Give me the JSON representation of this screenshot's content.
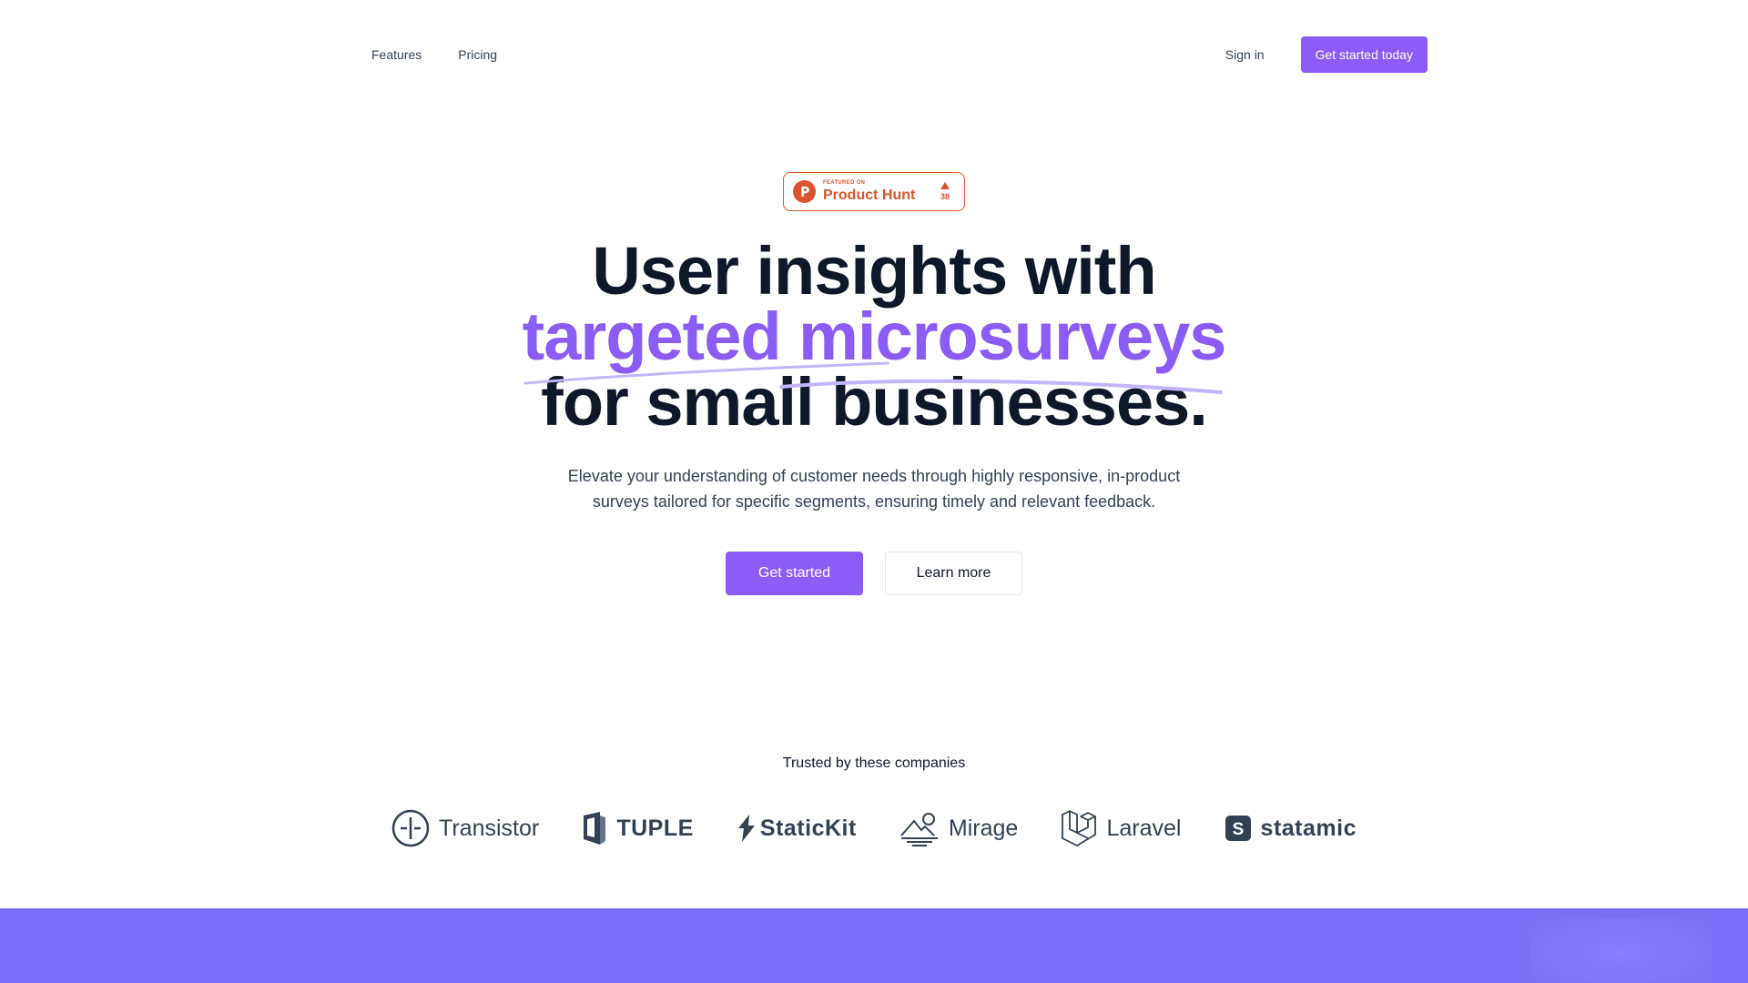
{
  "header": {
    "nav": [
      {
        "label": "Features"
      },
      {
        "label": "Pricing"
      }
    ],
    "sign_in_label": "Sign in",
    "cta_label": "Get started today"
  },
  "badge": {
    "featured_label": "FEATURED ON",
    "name": "Product Hunt",
    "votes": "38",
    "icon": "product-hunt-icon"
  },
  "hero": {
    "line1": "User insights with",
    "line2": "targeted microsurveys",
    "line3": "for small businesses.",
    "subtitle_line1": "Elevate your understanding of customer needs through highly responsive, in-product",
    "subtitle_line2": "surveys tailored for specific segments, ensuring timely and relevant feedback.",
    "primary_button": "Get started",
    "secondary_button": "Learn more"
  },
  "trusted": {
    "heading": "Trusted by these companies",
    "logos": [
      {
        "name": "Transistor",
        "icon": "transistor-logo"
      },
      {
        "name": "TUPLE",
        "icon": "tuple-logo"
      },
      {
        "name": "StaticKit",
        "icon": "statickit-logo"
      },
      {
        "name": "Mirage",
        "icon": "mirage-logo"
      },
      {
        "name": "Laravel",
        "icon": "laravel-logo"
      },
      {
        "name": "statamic",
        "icon": "statamic-logo"
      }
    ]
  },
  "colors": {
    "accent": "#8b5cf6",
    "text": "#0f172a",
    "muted": "#334155",
    "product_hunt": "#da552f",
    "band": "#7c6cf8"
  }
}
